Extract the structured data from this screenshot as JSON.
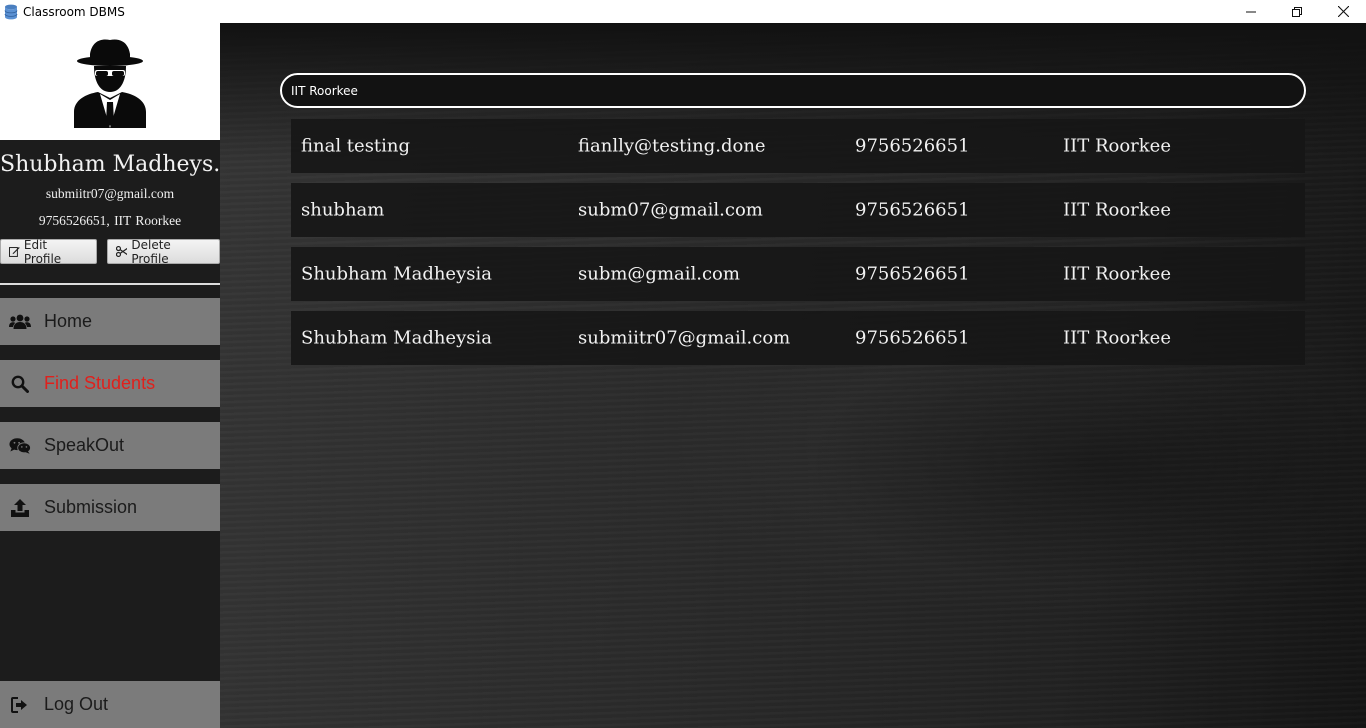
{
  "window": {
    "title": "Classroom DBMS"
  },
  "profile": {
    "name": "Shubham Madheys...",
    "email": "submiitr07@gmail.com",
    "phone": "9756526651,",
    "institute": "IIT Roorkee",
    "edit_label": "Edit Profile",
    "delete_label": "Delete Profile"
  },
  "nav": {
    "home": "Home",
    "find": "Find Students",
    "speakout": "SpeakOut",
    "submission": "Submission",
    "logout": "Log Out"
  },
  "search": {
    "value": "IIT Roorkee"
  },
  "results": [
    {
      "name": "final testing",
      "email": "fianlly@testing.done",
      "phone": "9756526651",
      "institute": "IIT Roorkee"
    },
    {
      "name": "shubham",
      "email": "subm07@gmail.com",
      "phone": "9756526651",
      "institute": "IIT Roorkee"
    },
    {
      "name": "Shubham Madheysia",
      "email": "subm@gmail.com",
      "phone": "9756526651",
      "institute": "IIT Roorkee"
    },
    {
      "name": "Shubham Madheysia",
      "email": "submiitr07@gmail.com",
      "phone": "9756526651",
      "institute": "IIT Roorkee"
    }
  ],
  "colors": {
    "active_nav_text": "#e0201c",
    "nav_bg": "#7b7b7b",
    "sidebar_bg": "#1c1c1c"
  },
  "icons": {
    "app": "database-icon",
    "home": "users-icon",
    "find": "search-icon",
    "speakout": "chat-icon",
    "submission": "upload-icon",
    "logout": "sign-out-icon",
    "edit": "edit-icon",
    "delete": "scissors-icon",
    "avatar": "spy-avatar-icon"
  }
}
